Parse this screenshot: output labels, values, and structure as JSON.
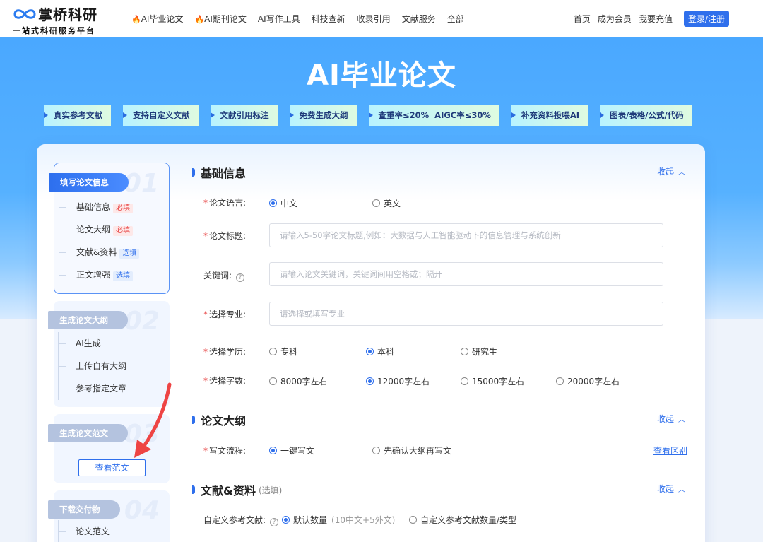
{
  "logo": {
    "name": "掌桥科研",
    "slogan": "一站式科研服务平台"
  },
  "nav": {
    "links": [
      {
        "label": "AI毕业论文",
        "hot": true
      },
      {
        "label": "AI期刊论文",
        "hot": true
      },
      {
        "label": "AI写作工具",
        "hot": false
      },
      {
        "label": "科技查新",
        "hot": false
      },
      {
        "label": "收录引用",
        "hot": false
      },
      {
        "label": "文献服务",
        "hot": false
      },
      {
        "label": "全部",
        "hot": false
      }
    ],
    "right": [
      "首页",
      "成为会员",
      "我要充值"
    ],
    "login": "登录/注册",
    "fire_glyph": "🔥"
  },
  "hero": {
    "title": "AI毕业论文",
    "features": [
      "真实参考文献",
      "支持自定义文献",
      "文献引用标注",
      "免费生成大纲",
      "查重率≤20%  AIGC率≤30%",
      "补充资料投喂AI",
      "图表/表格/公式/代码"
    ]
  },
  "sidebar": {
    "steps": [
      {
        "num": "01",
        "title": "填写论文信息",
        "items": [
          {
            "label": "基础信息",
            "tag": "必填",
            "tag_type": "req"
          },
          {
            "label": "论文大纲",
            "tag": "必填",
            "tag_type": "req"
          },
          {
            "label": "文献&资料",
            "tag": "选填",
            "tag_type": "opt"
          },
          {
            "label": "正文增强",
            "tag": "选填",
            "tag_type": "opt"
          }
        ]
      },
      {
        "num": "02",
        "title": "生成论文大纲",
        "items": [
          {
            "label": "AI生成"
          },
          {
            "label": "上传自有大纲"
          },
          {
            "label": "参考指定文章"
          }
        ]
      },
      {
        "num": "03",
        "title": "生成论文范文",
        "button": "查看范文"
      },
      {
        "num": "04",
        "title": "下载交付物",
        "items": [
          {
            "label": "论文范文"
          }
        ]
      }
    ]
  },
  "basic": {
    "title": "基础信息",
    "collapse": "收起",
    "language": {
      "label": "论文语言:",
      "options": [
        "中文",
        "英文"
      ],
      "selected": "中文"
    },
    "title_field": {
      "label": "论文标题:",
      "placeholder": "请输入5-50字论文标题,例如：大数据与人工智能驱动下的信息管理与系统创新"
    },
    "keywords": {
      "label": "关键词:",
      "placeholder": "请输入论文关键词，关键词间用空格或；隔开"
    },
    "major": {
      "label": "选择专业:",
      "placeholder": "请选择或填写专业"
    },
    "degree": {
      "label": "选择学历:",
      "options": [
        "专科",
        "本科",
        "研究生"
      ],
      "selected": "本科"
    },
    "words": {
      "label": "选择字数:",
      "options": [
        "8000字左右",
        "12000字左右",
        "15000字左右",
        "20000字左右"
      ],
      "selected": "12000字左右"
    }
  },
  "outline": {
    "title": "论文大纲",
    "collapse": "收起",
    "flow": {
      "label": "写文流程:",
      "options": [
        "一键写文",
        "先确认大纲再写文"
      ],
      "selected": "一键写文"
    },
    "diff_link": "查看区别"
  },
  "refs": {
    "title": "文献&资料",
    "sub": "(选填)",
    "collapse": "收起",
    "custom": {
      "label": "自定义参考文献:",
      "options": [
        "默认数量",
        "自定义参考文献数量/类型"
      ],
      "note": "(10中文+5外文)",
      "selected": "默认数量"
    }
  },
  "colors": {
    "accent": "#2f6fec",
    "required": "#e84545",
    "arrow": "#ee4444"
  }
}
